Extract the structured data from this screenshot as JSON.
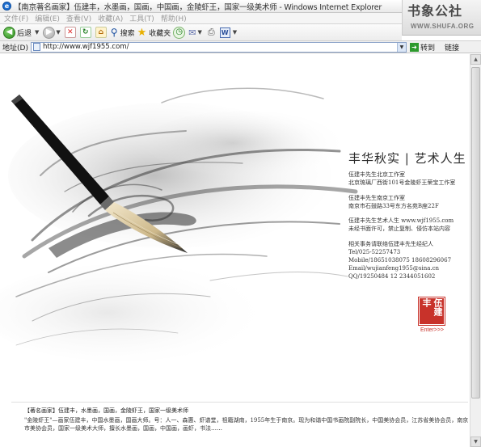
{
  "window": {
    "app_icon": "ie-icon",
    "title": "【南京著名画家】伍建丰，水墨画，国画，中国画，金陵虾王，国家一级美术师 - Windows Internet Explorer"
  },
  "watermark": {
    "text_cn": "书象公社",
    "text_en": "WWW.SHUFA.ORG"
  },
  "menu": [
    "文件(F)",
    "编辑(E)",
    "查看(V)",
    "收藏(A)",
    "工具(T)",
    "帮助(H)"
  ],
  "toolbar": {
    "back_label": "后退",
    "search_label": "搜索",
    "favorites_label": "收藏夹",
    "icons": [
      "back-icon",
      "forward-icon",
      "stop-icon",
      "refresh-icon",
      "home-icon",
      "search-icon",
      "star-icon",
      "history-icon",
      "mail-icon",
      "print-icon",
      "word-icon"
    ]
  },
  "address": {
    "label": "地址(D)",
    "url": "http://www.wjf1955.com/",
    "go_label": "转到",
    "links_label": "链接"
  },
  "page": {
    "headline": "丰华秋实 | 艺术人生",
    "info": [
      "伍建丰先生北京工作室",
      "北京琉璃厂西街101号金陵虾王荣宝工作室",
      "伍建丰先生南京工作室",
      "南京市石鼓路33号东方名苑B座22F",
      "伍建丰先生艺术人生  www.wjf1955.com",
      "未经书面许可，禁止复制、侵仿本站内容",
      "相关事务请联络伍建丰先生经纪人",
      "Tel/025-52257473",
      "Mobile/18651038075 18608296067",
      "Email/wujianfeng1955@sina.cn",
      "QQ/19250484 12 2344051602"
    ],
    "seal_text": "伍建丰",
    "enter_text": "Enter>>>",
    "bottom_title": "【著名画家】伍建丰，水墨画，国画，金陵虾王，国家一级美术师",
    "bottom_body": "\"金陵虾王\"—画家伍建丰，中国水墨画，国画大师。号：人一、森惠、虾谱堂，祖籍湖南，1955年生于南京。现为和谐中国书画院副院长，中国美协会员，江苏省美协会员，南京市美协会员，国家一级美术大师，擅长水墨画，国画，中国画，画虾，书法……"
  }
}
